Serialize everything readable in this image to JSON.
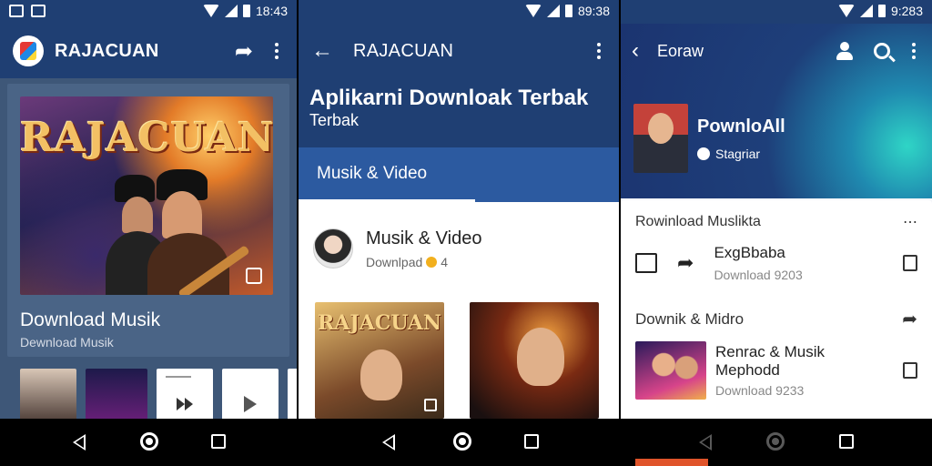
{
  "colors": {
    "primary": "#1f3f73",
    "tab": "#2c5aa0",
    "panel1_bg": "#3e5778",
    "card_bg": "#4a6486"
  },
  "screen1": {
    "status": {
      "time": "18:43"
    },
    "toolbar": {
      "title": "RAJACUAN",
      "share_icon": "share-icon",
      "menu_icon": "more-vert-icon"
    },
    "hero": {
      "logo_text": "RAJACUAN",
      "title": "Download Musik",
      "subtitle": "Dewnload Musik"
    }
  },
  "screen2": {
    "status": {
      "time": "89:38"
    },
    "toolbar": {
      "title": "RAJACUAN"
    },
    "headline": "Aplikarni Downloak Terbak",
    "subheadline": "Terbak",
    "tab": "Musik & Video",
    "row": {
      "title": "Musik & Video",
      "subtitle": "Downlpad",
      "badge": "4"
    },
    "card_logo": "RAJACUAN"
  },
  "screen3": {
    "status": {
      "time": "9:283"
    },
    "toolbar": {
      "title": "Eoraw"
    },
    "profile": {
      "name": "PownloAll",
      "tag": "Stagriar"
    },
    "section1": {
      "title": "Rowinload Muslikta",
      "more": "⋯"
    },
    "item1": {
      "title": "ExgBbaba",
      "subtitle": "Download 9203"
    },
    "section2": {
      "title": "Downik & Midro"
    },
    "item2": {
      "title": "Renrac & Musik",
      "title2": "Mephodd",
      "subtitle": "Download 9233"
    }
  }
}
